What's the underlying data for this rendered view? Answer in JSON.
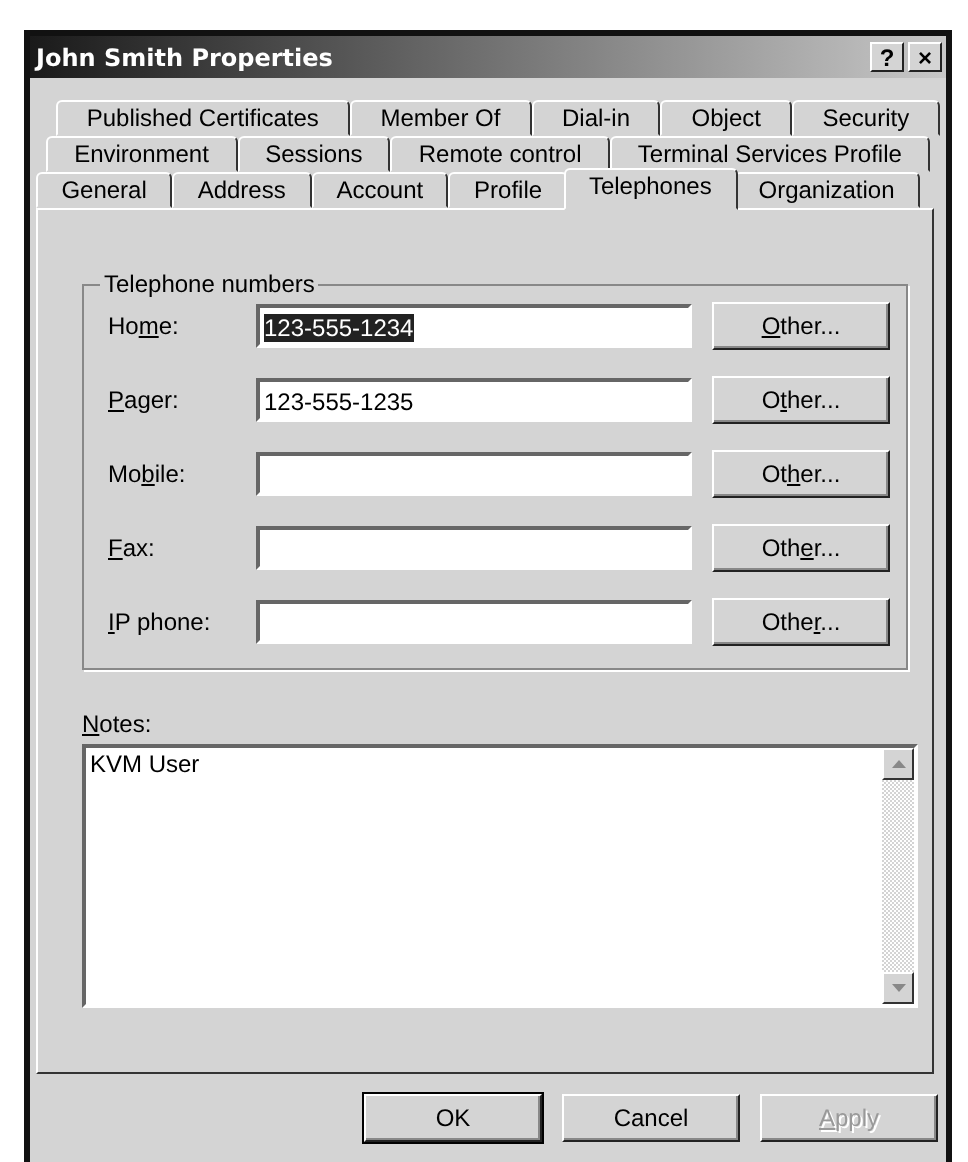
{
  "window": {
    "title": "John Smith Properties",
    "help_button": "?",
    "close_button": "×"
  },
  "tab_rows": [
    [
      {
        "label": "Published Certificates",
        "selected": false
      },
      {
        "label": "Member Of",
        "selected": false
      },
      {
        "label": "Dial-in",
        "selected": false
      },
      {
        "label": "Object",
        "selected": false
      },
      {
        "label": "Security",
        "selected": false
      }
    ],
    [
      {
        "label": "Environment",
        "selected": false
      },
      {
        "label": "Sessions",
        "selected": false
      },
      {
        "label": "Remote control",
        "selected": false
      },
      {
        "label": "Terminal Services Profile",
        "selected": false
      }
    ],
    [
      {
        "label": "General",
        "selected": false
      },
      {
        "label": "Address",
        "selected": false
      },
      {
        "label": "Account",
        "selected": false
      },
      {
        "label": "Profile",
        "selected": false
      },
      {
        "label": "Telephones",
        "selected": true
      },
      {
        "label": "Organization",
        "selected": false
      }
    ]
  ],
  "group": {
    "title": "Telephone numbers",
    "rows": [
      {
        "label": {
          "before": "Ho",
          "key": "m",
          "after": "e:"
        },
        "value": "123-555-1234",
        "selected": true,
        "button": {
          "key": "O",
          "after": "ther..."
        }
      },
      {
        "label": {
          "key": "P",
          "after": "ager:"
        },
        "value": "123-555-1235",
        "selected": false,
        "button": {
          "before": "O",
          "key": "t",
          "after": "her..."
        }
      },
      {
        "label": {
          "before": "Mo",
          "key": "b",
          "after": "ile:"
        },
        "selected": false,
        "button": {
          "before": "Ot",
          "key": "h",
          "after": "er..."
        }
      },
      {
        "label": {
          "key": "F",
          "after": "ax:"
        },
        "selected": false,
        "button": {
          "before": "Oth",
          "key": "e",
          "after": "r..."
        }
      },
      {
        "label": {
          "key": "I",
          "after": "P phone:"
        },
        "selected": false,
        "button": {
          "before": "Othe",
          "key": "r",
          "after": "..."
        }
      }
    ]
  },
  "notes": {
    "label": {
      "key": "N",
      "after": "otes:"
    },
    "value": "KVM User"
  },
  "buttons": [
    {
      "label": {
        "after": "OK"
      },
      "default": true,
      "disabled": false
    },
    {
      "label": {
        "after": "Cancel"
      },
      "default": false,
      "disabled": false
    },
    {
      "label": {
        "key": "A",
        "after": "pply"
      },
      "default": false,
      "disabled": true
    }
  ]
}
